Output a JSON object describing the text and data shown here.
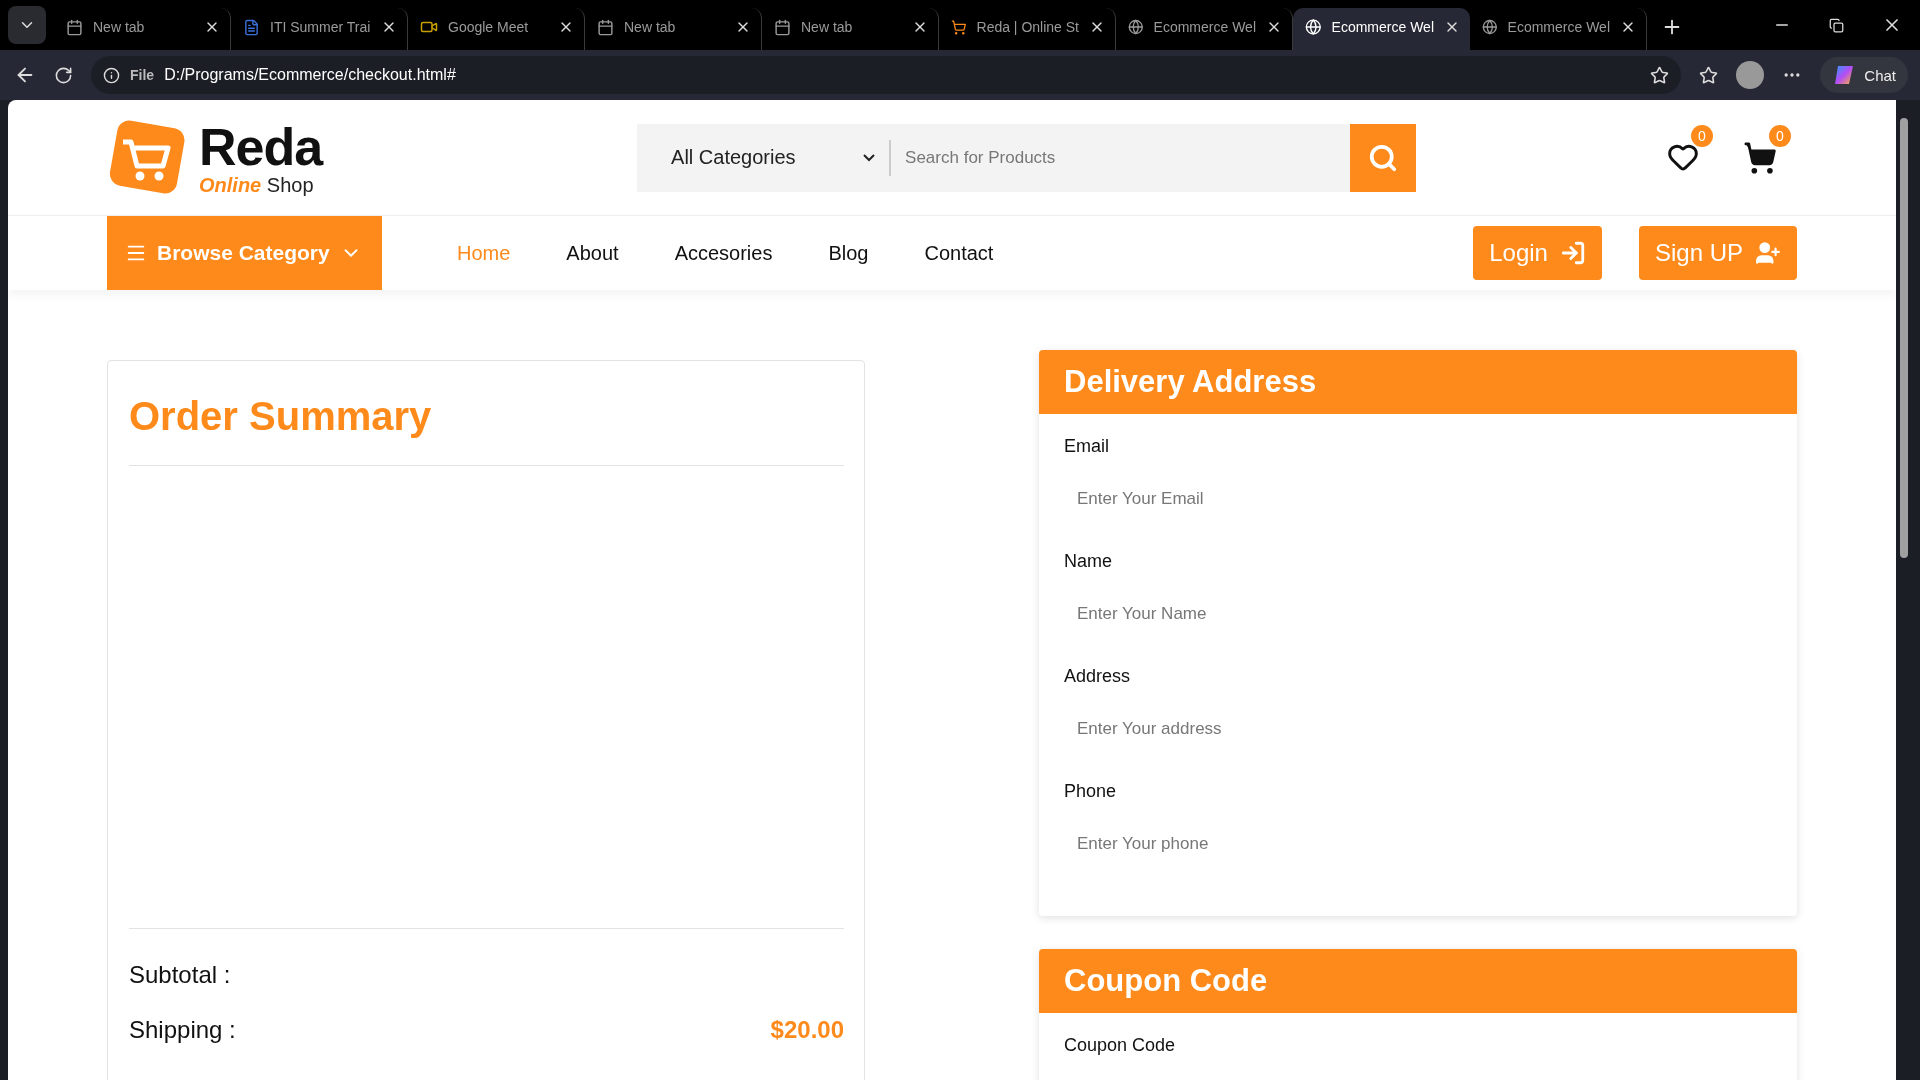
{
  "browser": {
    "tabs": [
      {
        "kind": "blank",
        "title": "New tab",
        "selected": false
      },
      {
        "kind": "doc",
        "title": "ITI Summer Trai",
        "selected": false
      },
      {
        "kind": "video",
        "title": "Google Meet",
        "selected": false
      },
      {
        "kind": "blank",
        "title": "New tab",
        "selected": false
      },
      {
        "kind": "blank",
        "title": "New tab",
        "selected": false
      },
      {
        "kind": "shop",
        "title": "Reda | Online St",
        "selected": false
      },
      {
        "kind": "globe",
        "title": "Ecommerce Wel",
        "selected": false
      },
      {
        "kind": "globe",
        "title": "Ecommerce Wel",
        "selected": true
      },
      {
        "kind": "globe",
        "title": "Ecommerce Wel",
        "selected": false
      }
    ],
    "address": {
      "scheme": "File",
      "url": "D:/Programs/Ecommerce/checkout.html#"
    },
    "chat_button": "Chat"
  },
  "header": {
    "logo": {
      "name": "Reda",
      "accent": "Online",
      "tagline": "Shop"
    },
    "search": {
      "category": "All Categories",
      "placeholder": "Search for Products"
    },
    "wishlist_count": "0",
    "cart_count": "0"
  },
  "nav": {
    "browse": "Browse Category",
    "links": [
      {
        "label": "Home",
        "selected": true
      },
      {
        "label": "About",
        "selected": false
      },
      {
        "label": "Accesories",
        "selected": false
      },
      {
        "label": "Blog",
        "selected": false
      },
      {
        "label": "Contact",
        "selected": false
      }
    ],
    "login": "Login",
    "signup": "Sign UP"
  },
  "order_summary": {
    "title": "Order Summary",
    "rows": [
      {
        "label": "Subtotal :"
      },
      {
        "label": "Shipping :",
        "value": "$20.00"
      }
    ]
  },
  "delivery": {
    "title": "Delivery Address",
    "fields": [
      {
        "label": "Email",
        "placeholder": "Enter Your Email"
      },
      {
        "label": "Name",
        "placeholder": "Enter Your Name"
      },
      {
        "label": "Address",
        "placeholder": "Enter Your address"
      },
      {
        "label": "Phone",
        "placeholder": "Enter Your phone"
      }
    ]
  },
  "coupon": {
    "title": "Coupon Code",
    "fields": [
      {
        "label": "Coupon Code"
      }
    ]
  }
}
